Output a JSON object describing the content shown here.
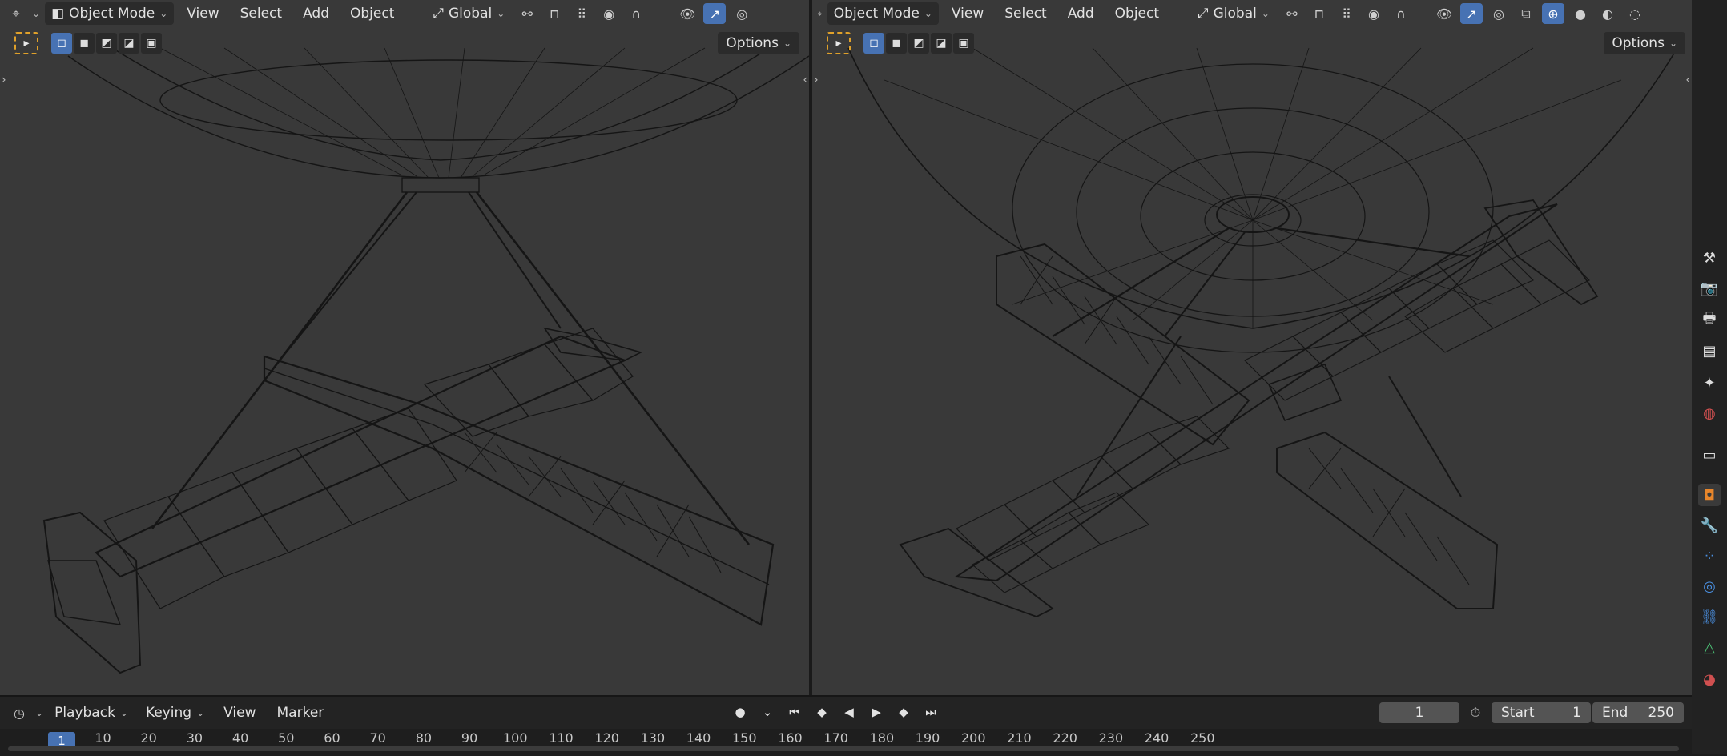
{
  "viewport_left": {
    "mode": "Object Mode",
    "menus": [
      "View",
      "Select",
      "Add",
      "Object"
    ],
    "orientation": "Global",
    "options": "Options"
  },
  "viewport_right": {
    "mode": "Object Mode",
    "menus": [
      "View",
      "Select",
      "Add",
      "Object"
    ],
    "orientation": "Global",
    "options": "Options"
  },
  "timeline": {
    "menus": [
      "Playback",
      "Keying",
      "View",
      "Marker"
    ],
    "current_frame": "1",
    "start_label": "Start",
    "start_value": "1",
    "end_label": "End",
    "end_value": "250",
    "ruler_ticks": [
      "1",
      "10",
      "20",
      "30",
      "40",
      "50",
      "60",
      "70",
      "80",
      "90",
      "100",
      "110",
      "120",
      "130",
      "140",
      "150",
      "160",
      "170",
      "180",
      "190",
      "200",
      "210",
      "220",
      "230",
      "240",
      "250"
    ]
  },
  "colors": {
    "accent": "#4772b3",
    "viewport_bg": "#393939",
    "wire": "#141414",
    "active_tool": "#e0a12a"
  },
  "icons": {
    "properties": [
      "tool-icon",
      "render-icon",
      "output-icon",
      "view-layer-icon",
      "scene-icon",
      "world-icon",
      "collection-icon",
      "object-icon",
      "modifier-icon",
      "particles-icon",
      "physics-icon",
      "constraints-icon",
      "data-icon",
      "material-icon"
    ]
  }
}
